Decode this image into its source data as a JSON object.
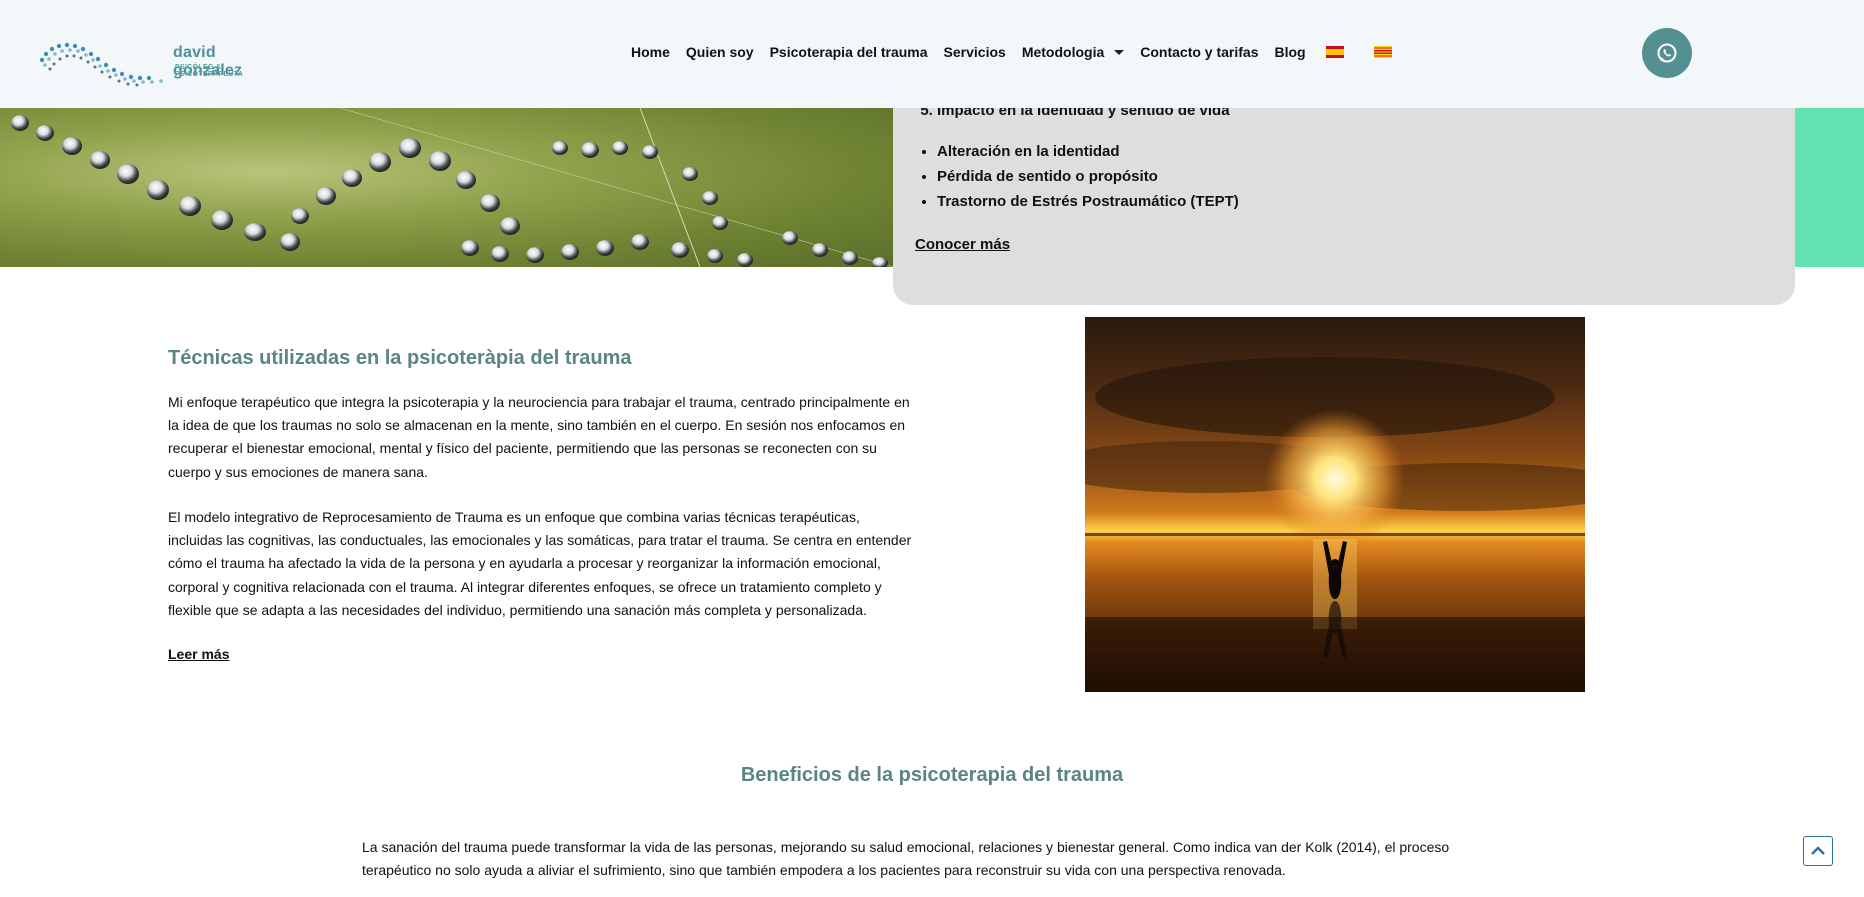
{
  "logo": {
    "name": "david gonzalez",
    "tagline": "PSICÒLEG & PSICOTERAPEUTA",
    "colors": {
      "primary": "#4f8f9f",
      "accent": "#55a59a"
    }
  },
  "nav": {
    "items": [
      {
        "label": "Home"
      },
      {
        "label": "Quien soy"
      },
      {
        "label": "Psicoterapia del trauma"
      },
      {
        "label": "Servicios"
      },
      {
        "label": "Metodologia",
        "has_dropdown": true
      },
      {
        "label": "Contacto y tarifas"
      },
      {
        "label": "Blog"
      }
    ],
    "languages": [
      {
        "icon": "flag-spain-icon"
      },
      {
        "icon": "flag-catalonia-icon"
      }
    ],
    "whatsapp_icon": "whatsapp-icon",
    "whatsapp_color": "#548f92"
  },
  "info_card": {
    "ordered_item": "Impacto en la identidad y sentido de vida",
    "ordered_start": 5,
    "bullets": [
      "Alteración en la identidad",
      "Pérdida de sentido o propósito",
      "Trastorno de Estrés Postraumático (TEPT)"
    ],
    "link": "Conocer más"
  },
  "techniques": {
    "title": "Técnicas utilizadas en la psicoteràpia del trauma",
    "paragraphs": [
      "Mi enfoque terapéutico que integra la psicoterapia y la neurociencia para trabajar el trauma, centrado principalmente en la idea de que los traumas no solo se almacenan en la mente, sino también en el cuerpo. En sesión nos enfocamos en recuperar el bienestar emocional, mental y físico del paciente, permitiendo que las personas se reconecten con su cuerpo y sus emociones de manera sana.",
      "El modelo integrativo de Reprocesamiento de Trauma es un enfoque que combina varias técnicas terapéuticas, incluidas las cognitivas, las conductuales, las emocionales y las somáticas, para tratar el trauma. Se centra en entender cómo el trauma ha afectado la vida de la persona y en ayudarla a procesar y reorganizar la información emocional, corporal y cognitiva relacionada con el trauma. Al integrar diferentes enfoques, se ofrece un tratamiento completo y flexible que se adapta a las necesidades del individuo, permitiendo una sanación más completa y personalizada."
    ],
    "link": "Leer más"
  },
  "benefits": {
    "title": "Beneficios de la psicoterapia del trauma",
    "text": "La sanación del trauma puede transformar la vida de las personas, mejorando su salud emocional, relaciones y bienestar general. Como indica van der Kolk (2014), el proceso terapéutico no solo ayuda a aliviar el sufrimiento, sino que también empodera a los pacientes para reconstruir su vida con una perspectiva renovada."
  },
  "scroll_top_icon": "chevron-up-icon"
}
